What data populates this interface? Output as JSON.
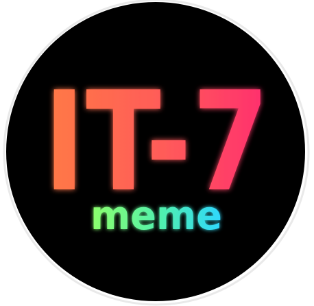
{
  "logo": {
    "main_text": "IT-7",
    "sub_text": "meme"
  },
  "colors": {
    "background_circle": "#000000",
    "page_background": "#ffffff",
    "main_gradient_start": "#ff7a45",
    "main_gradient_end": "#ff2d6f",
    "sub_gradient_start": "#8dff6a",
    "sub_gradient_end": "#2ed7ff"
  }
}
